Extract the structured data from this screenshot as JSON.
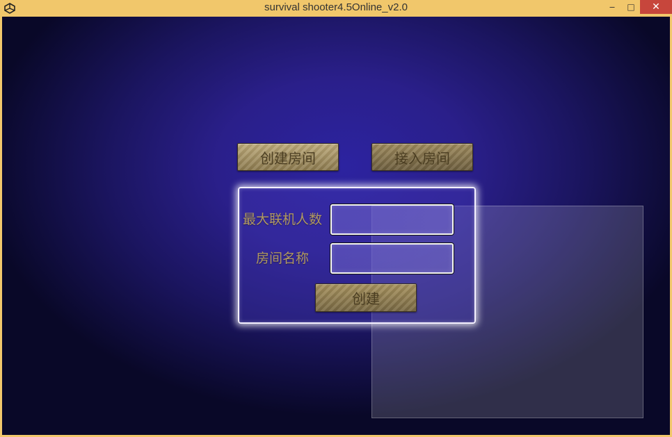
{
  "window": {
    "title": "survival shooter4.5Online_v2.0",
    "app_icon": "unity-logo-icon",
    "minimize_glyph": "‒",
    "maximize_glyph": "□",
    "close_glyph": "✕",
    "close_color": "#c7463c"
  },
  "tabs": {
    "create_room": "创建房间",
    "join_room": "接入房间"
  },
  "form": {
    "max_players_label": "最大联机人数",
    "max_players_value": "",
    "room_name_label": "房间名称",
    "room_name_value": "",
    "create_button": "创建"
  }
}
